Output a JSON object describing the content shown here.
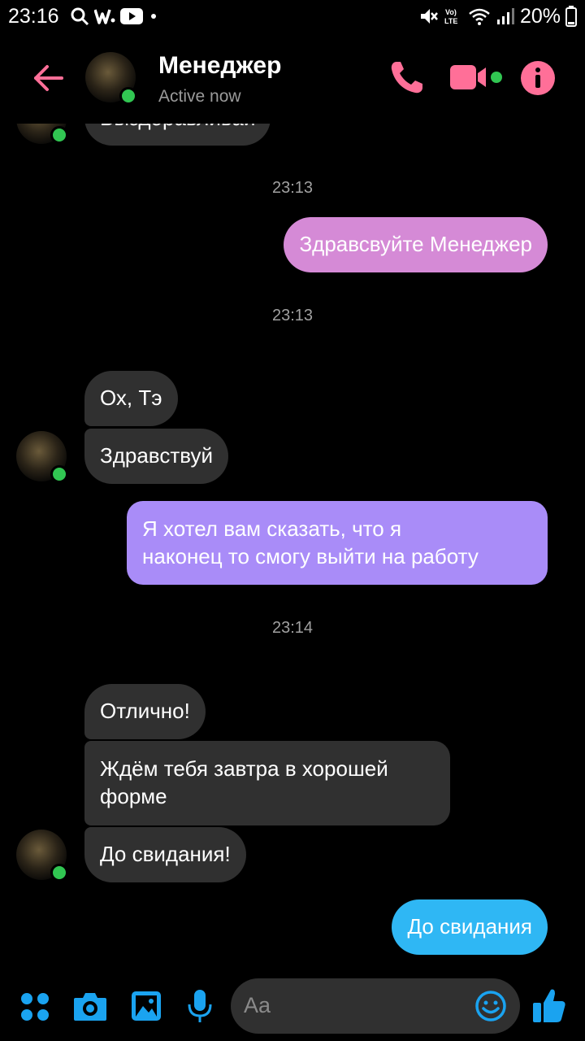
{
  "status_bar": {
    "time": "23:16",
    "battery": "20%"
  },
  "header": {
    "contact_name": "Менеджер",
    "presence": "Active now"
  },
  "messages": {
    "partial_top": "Выздоравливай",
    "ts1": "23:13",
    "m1": "Здравсвуйте Менеджер",
    "ts2": "23:13",
    "m2": "Ох, Тэ",
    "m3": "Здравствуй",
    "m4_line1": "Я хотел вам сказать, что я",
    "m4_line2": "наконец то смогу выйти на работу",
    "ts3": "23:14",
    "m5": "Отлично!",
    "m6_line1": "Ждём тебя завтра в хорошей",
    "m6_line2": "форме",
    "m7": "До свидания!",
    "m8": "До свидания"
  },
  "composer": {
    "placeholder": "Aa"
  },
  "colors": {
    "accent": "#ff6f98",
    "bubble_pink": "#d58ad6",
    "bubble_violet": "#a98cf8",
    "bubble_blue": "#2fb7f4",
    "incoming": "#303030",
    "online": "#31c652",
    "composer_blue": "#1aa3f0"
  }
}
